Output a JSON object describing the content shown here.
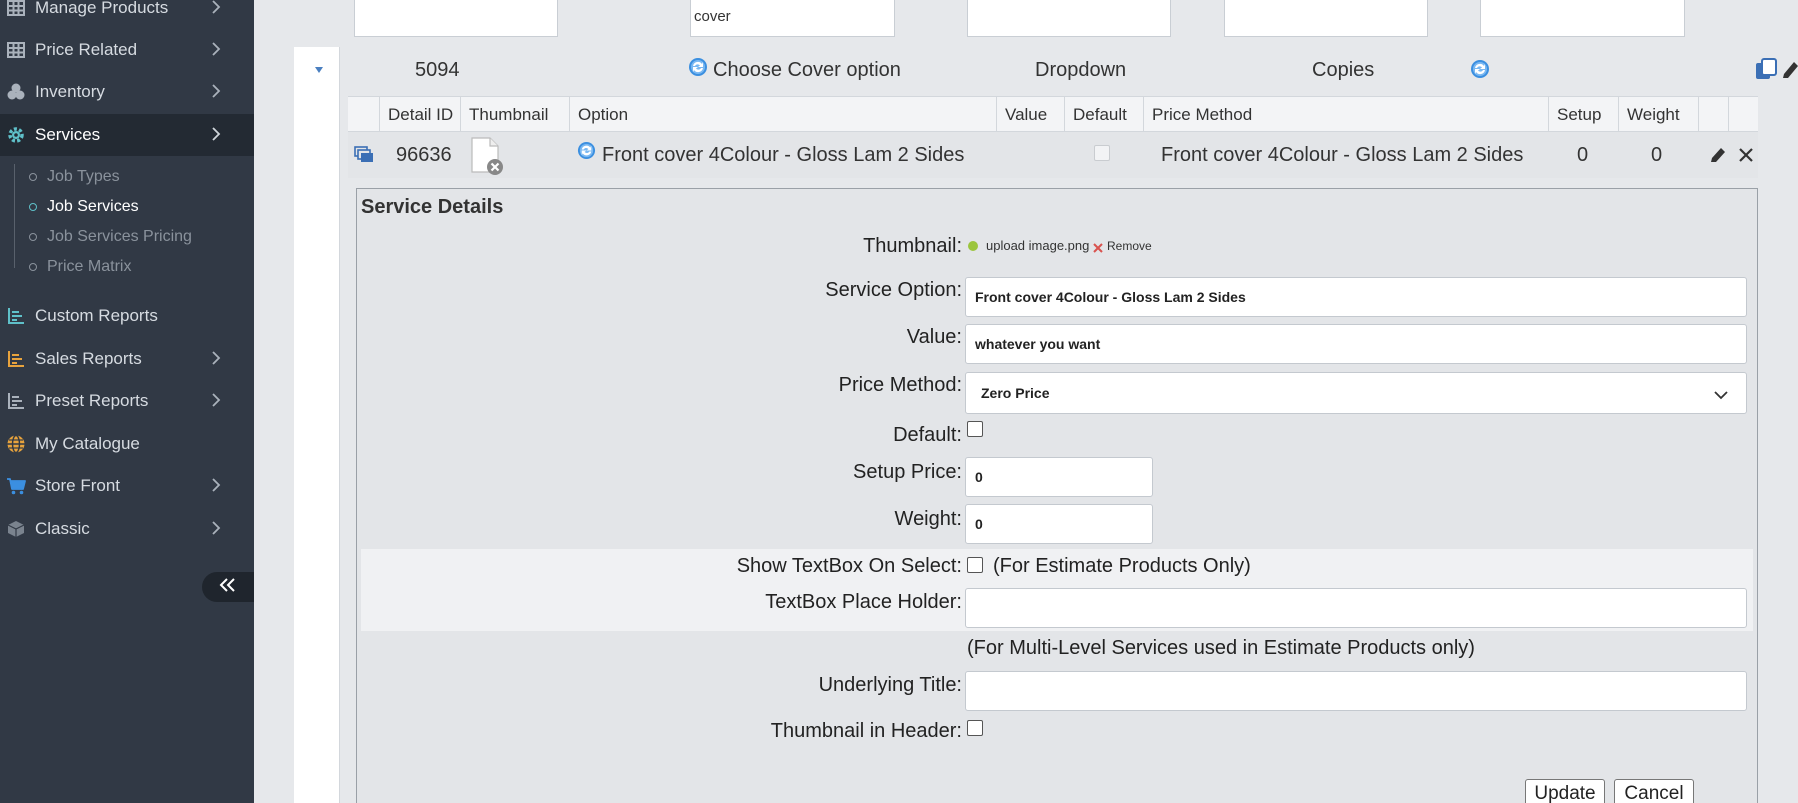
{
  "sidebar": {
    "items": [
      {
        "label": "Manage Products",
        "icon": "table-icon"
      },
      {
        "label": "Price Related",
        "icon": "table-icon"
      },
      {
        "label": "Inventory",
        "icon": "cubes-icon"
      },
      {
        "label": "Services",
        "icon": "gear-icon"
      },
      {
        "label": "Custom Reports",
        "icon": "chart-icon"
      },
      {
        "label": "Sales Reports",
        "icon": "chart-icon"
      },
      {
        "label": "Preset Reports",
        "icon": "chart-icon"
      },
      {
        "label": "My Catalogue",
        "icon": "globe-icon"
      },
      {
        "label": "Store Front",
        "icon": "cart-icon"
      },
      {
        "label": "Classic",
        "icon": "box-icon"
      }
    ],
    "sub_items": [
      {
        "label": "Job Types"
      },
      {
        "label": "Job Services"
      },
      {
        "label": "Job Services Pricing"
      },
      {
        "label": "Price Matrix"
      }
    ],
    "colors": {
      "bg": "#313945",
      "active_bg": "#232a33",
      "accent_teal": "#5fc0c9",
      "accent_orange": "#e8a33d",
      "accent_blue": "#3b8fe0"
    }
  },
  "filters": {
    "cover_value": "cover"
  },
  "group_row": {
    "id": "5094",
    "name": "Choose Cover option",
    "type": "Dropdown",
    "unit": "Copies"
  },
  "grid": {
    "headers": [
      "Detail ID",
      "Thumbnail",
      "Option",
      "Value",
      "Default",
      "Price Method",
      "Setup",
      "Weight"
    ],
    "row": {
      "detail_id": "96636",
      "option": "Front cover 4Colour - Gloss Lam 2 Sides",
      "price_method": "Front cover 4Colour - Gloss Lam 2 Sides",
      "setup": "0",
      "weight": "0"
    }
  },
  "details": {
    "title": "Service Details",
    "thumbnail_label": "Thumbnail:",
    "thumbnail_file": "upload image.png",
    "remove_label": "Remove",
    "service_option_label": "Service Option:",
    "service_option_value": "Front cover 4Colour - Gloss Lam 2 Sides",
    "value_label": "Value:",
    "value_value": "whatever you want",
    "price_method_label": "Price Method:",
    "price_method_value": "Zero Price",
    "default_label": "Default:",
    "setup_price_label": "Setup Price:",
    "setup_price_value": "0",
    "weight_label": "Weight:",
    "weight_value": "0",
    "show_textbox_label": "Show TextBox On Select:",
    "show_textbox_note": "(For Estimate Products Only)",
    "placeholder_label": "TextBox Place Holder:",
    "multilevel_note": "(For Multi-Level Services used in Estimate Products only)",
    "underlying_title_label": "Underlying Title:",
    "thumb_header_label": "Thumbnail in Header:",
    "update_label": "Update",
    "cancel_label": "Cancel"
  }
}
